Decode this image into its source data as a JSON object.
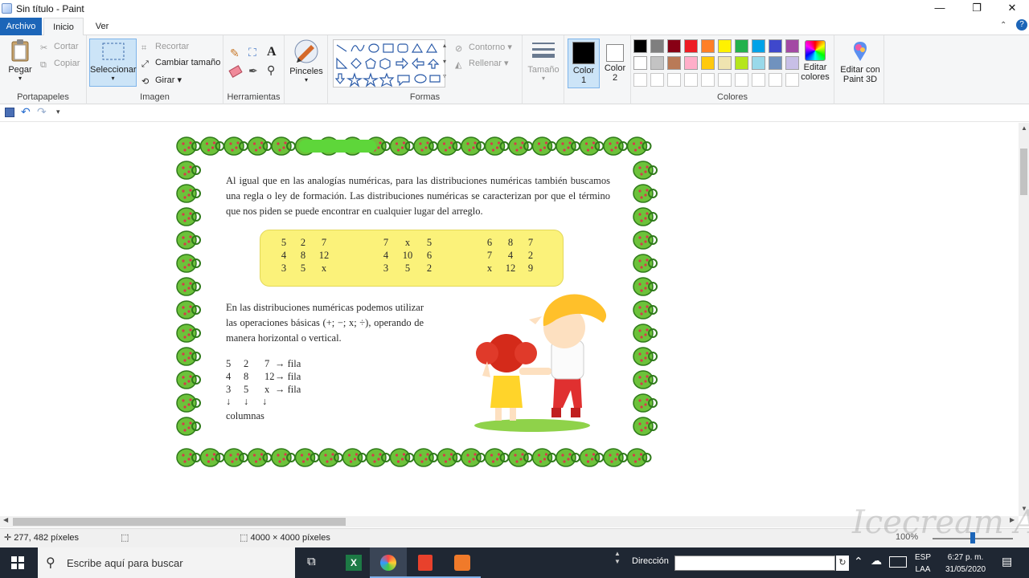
{
  "window": {
    "title": "Sin título - Paint"
  },
  "tabs": [
    {
      "label": "Archivo"
    },
    {
      "label": "Inicio"
    },
    {
      "label": "Ver"
    }
  ],
  "ribbon": {
    "portapapeles": {
      "label": "Portapapeles",
      "paste": "Pegar",
      "cut": "Cortar",
      "copy": "Copiar"
    },
    "imagen": {
      "label": "Imagen",
      "select": "Seleccionar",
      "crop": "Recortar",
      "resize": "Cambiar tamaño",
      "rotate": "Girar"
    },
    "herramientas": {
      "label": "Herramientas"
    },
    "pinceles": {
      "label": "Pinceles"
    },
    "formas": {
      "label": "Formas",
      "outline": "Contorno",
      "fill": "Rellenar"
    },
    "tamano": {
      "label": "Tamaño"
    },
    "color1": {
      "label": "Color\n1",
      "line1": "Color",
      "line2": "1",
      "value": "#000000"
    },
    "color2": {
      "line1": "Color",
      "line2": "2",
      "value": "#ffffff"
    },
    "colores": {
      "label": "Colores",
      "edit_line1": "Editar",
      "edit_line2": "colores"
    },
    "paint3d": {
      "line1": "Editar con",
      "line2": "Paint 3D"
    },
    "palette_row1": [
      "#000000",
      "#7f7f7f",
      "#880015",
      "#ed1c24",
      "#ff7f27",
      "#fff200",
      "#22b14c",
      "#00a2e8",
      "#3f48cc",
      "#a349a4"
    ],
    "palette_row2": [
      "#ffffff",
      "#c3c3c3",
      "#b97a57",
      "#ffaec9",
      "#ffc90e",
      "#efe4b0",
      "#b5e61d",
      "#99d9ea",
      "#7092be",
      "#c8bfe7"
    ]
  },
  "document": {
    "para1": "Al igual que en las analogías numéricas, para las distribuciones numéricas también buscamos una regla o ley de formación. Las distribuciones numéricas se caracterizan por que el término que nos piden se puede encontrar en cualquier lugar del arreglo.",
    "grids": [
      [
        [
          "5",
          "2",
          "7"
        ],
        [
          "4",
          "8",
          "12"
        ],
        [
          "3",
          "5",
          "x"
        ]
      ],
      [
        [
          "7",
          "x",
          "5"
        ],
        [
          "4",
          "10",
          "6"
        ],
        [
          "3",
          "5",
          "2"
        ]
      ],
      [
        [
          "6",
          "8",
          "7"
        ],
        [
          "7",
          "4",
          "2"
        ],
        [
          "x",
          "12",
          "9"
        ]
      ]
    ],
    "para2": "En las distribuciones numéricas podemos utilizar las operaciones básicas (+; −; x; ÷), operando de manera horizontal o vertical.",
    "example_rows": [
      {
        "a": "5",
        "b": "2",
        "c": "7",
        "label": "→ fila"
      },
      {
        "a": "4",
        "b": "8",
        "c": "12",
        "label": "→ fila"
      },
      {
        "a": "3",
        "b": "5",
        "c": "x",
        "label": "→ fila"
      }
    ],
    "arrow": "↓",
    "columns_label": "columnas"
  },
  "status": {
    "cursor": "277, 482 píxeles",
    "size": "4000 × 4000 píxeles",
    "zoom": "100%"
  },
  "taskbar": {
    "search_placeholder": "Escribe aquí para buscar",
    "address_label": "Dirección",
    "lang1": "ESP",
    "lang2": "LAA",
    "time": "6:27 p. m.",
    "date": "31/05/2020"
  },
  "watermark": "Icecream APPS"
}
